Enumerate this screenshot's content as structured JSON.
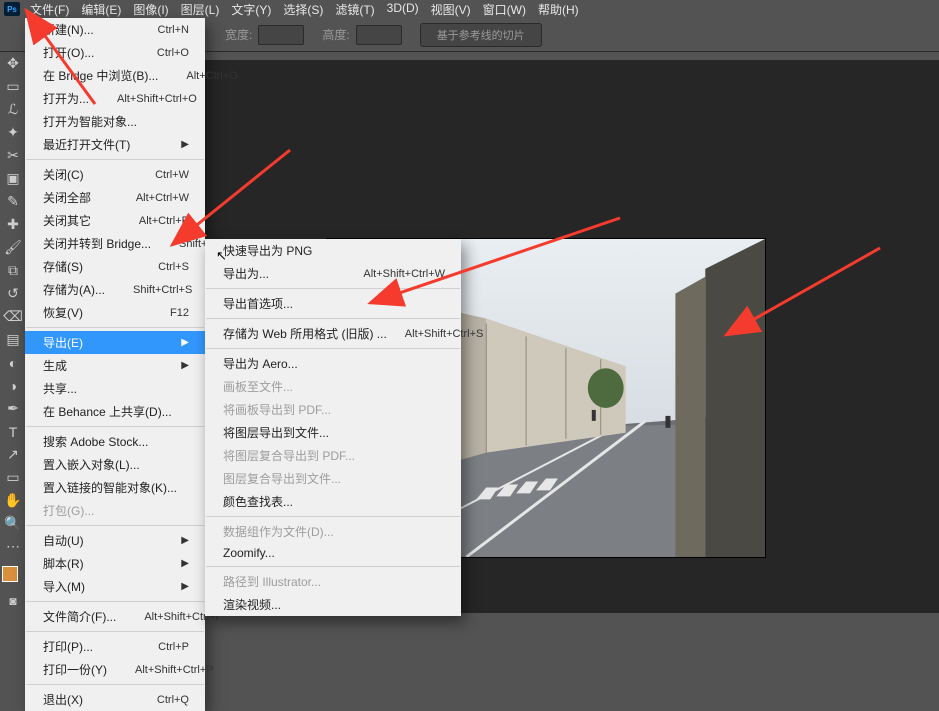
{
  "menubar": {
    "items": [
      "文件(F)",
      "编辑(E)",
      "图像(I)",
      "图层(L)",
      "文字(Y)",
      "选择(S)",
      "滤镜(T)",
      "3D(D)",
      "视图(V)",
      "窗口(W)",
      "帮助(H)"
    ]
  },
  "optionsbar": {
    "width_label": "宽度:",
    "height_label": "高度:",
    "slice_button": "基于参考线的切片"
  },
  "toolbar": {
    "tools": [
      "move",
      "marquee",
      "lasso",
      "wand",
      "crop",
      "frame",
      "eyedropper",
      "heal",
      "brush",
      "stamp",
      "history",
      "eraser",
      "gradient",
      "blur",
      "dodge",
      "pen",
      "type",
      "path",
      "rectangle",
      "hand",
      "zoom",
      "more"
    ]
  },
  "file_menu": {
    "groups": [
      [
        {
          "label": "新建(N)...",
          "shortcut": "Ctrl+N"
        },
        {
          "label": "打开(O)...",
          "shortcut": "Ctrl+O"
        },
        {
          "label": "在 Bridge 中浏览(B)...",
          "shortcut": "Alt+Ctrl+O"
        },
        {
          "label": "打开为...",
          "shortcut": "Alt+Shift+Ctrl+O"
        },
        {
          "label": "打开为智能对象..."
        },
        {
          "label": "最近打开文件(T)",
          "submenu": true
        }
      ],
      [
        {
          "label": "关闭(C)",
          "shortcut": "Ctrl+W"
        },
        {
          "label": "关闭全部",
          "shortcut": "Alt+Ctrl+W"
        },
        {
          "label": "关闭其它",
          "shortcut": "Alt+Ctrl+P"
        },
        {
          "label": "关闭并转到 Bridge...",
          "shortcut": "Shift+Ctrl+W"
        },
        {
          "label": "存储(S)",
          "shortcut": "Ctrl+S"
        },
        {
          "label": "存储为(A)...",
          "shortcut": "Shift+Ctrl+S"
        },
        {
          "label": "恢复(V)",
          "shortcut": "F12"
        }
      ],
      [
        {
          "label": "导出(E)",
          "submenu": true,
          "selected": true
        },
        {
          "label": "生成",
          "submenu": true
        },
        {
          "label": "共享..."
        },
        {
          "label": "在 Behance 上共享(D)..."
        }
      ],
      [
        {
          "label": "搜索 Adobe Stock..."
        },
        {
          "label": "置入嵌入对象(L)..."
        },
        {
          "label": "置入链接的智能对象(K)..."
        },
        {
          "label": "打包(G)...",
          "disabled": true
        }
      ],
      [
        {
          "label": "自动(U)",
          "submenu": true
        },
        {
          "label": "脚本(R)",
          "submenu": true
        },
        {
          "label": "导入(M)",
          "submenu": true
        }
      ],
      [
        {
          "label": "文件简介(F)...",
          "shortcut": "Alt+Shift+Ctrl+I"
        }
      ],
      [
        {
          "label": "打印(P)...",
          "shortcut": "Ctrl+P"
        },
        {
          "label": "打印一份(Y)",
          "shortcut": "Alt+Shift+Ctrl+P"
        }
      ],
      [
        {
          "label": "退出(X)",
          "shortcut": "Ctrl+Q"
        }
      ]
    ]
  },
  "export_menu": {
    "groups": [
      [
        {
          "label": "快速导出为 PNG"
        },
        {
          "label": "导出为...",
          "shortcut": "Alt+Shift+Ctrl+W"
        }
      ],
      [
        {
          "label": "导出首选项..."
        }
      ],
      [
        {
          "label": "存储为 Web 所用格式 (旧版) ...",
          "shortcut": "Alt+Shift+Ctrl+S"
        }
      ],
      [
        {
          "label": "导出为 Aero..."
        },
        {
          "label": "画板至文件...",
          "disabled": true
        },
        {
          "label": "将画板导出到 PDF...",
          "disabled": true
        },
        {
          "label": "将图层导出到文件..."
        },
        {
          "label": "将图层复合导出到 PDF...",
          "disabled": true
        },
        {
          "label": "图层复合导出到文件...",
          "disabled": true
        },
        {
          "label": "颜色查找表..."
        }
      ],
      [
        {
          "label": "数据组作为文件(D)...",
          "disabled": true
        },
        {
          "label": "Zoomify..."
        }
      ],
      [
        {
          "label": "路径到 Illustrator...",
          "disabled": true
        },
        {
          "label": "渲染视频..."
        }
      ]
    ]
  }
}
